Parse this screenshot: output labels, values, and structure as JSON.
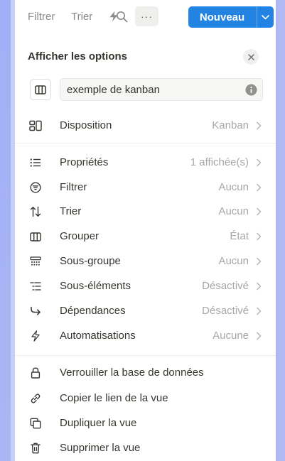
{
  "toolbar": {
    "filter_label": "Filtrer",
    "sort_label": "Trier",
    "automation_icon": "lightning-icon",
    "search_icon": "search-icon",
    "more_label": "···",
    "new_label": "Nouveau",
    "accent_color": "#2383e2"
  },
  "options": {
    "title": "Afficher les options",
    "view_name": "exemple de kanban"
  },
  "layout_row": {
    "icon": "layout-icon",
    "label": "Disposition",
    "value": "Kanban"
  },
  "settings": [
    {
      "icon": "list-icon",
      "label": "Propriétés",
      "value": "1 affichée(s)"
    },
    {
      "icon": "filter-icon",
      "label": "Filtrer",
      "value": "Aucun"
    },
    {
      "icon": "sort-icon",
      "label": "Trier",
      "value": "Aucun"
    },
    {
      "icon": "columns-icon",
      "label": "Grouper",
      "value": "État"
    },
    {
      "icon": "subgroup-icon",
      "label": "Sous-groupe",
      "value": "Aucun"
    },
    {
      "icon": "subitems-icon",
      "label": "Sous-éléments",
      "value": "Désactivé"
    },
    {
      "icon": "dependency-icon",
      "label": "Dépendances",
      "value": "Désactivé"
    },
    {
      "icon": "lightning-icon",
      "label": "Automatisations",
      "value": "Aucune"
    }
  ],
  "actions": [
    {
      "icon": "lock-icon",
      "label": "Verrouiller la base de données"
    },
    {
      "icon": "link-icon",
      "label": "Copier le lien de la vue"
    },
    {
      "icon": "duplicate-icon",
      "label": "Dupliquer la vue"
    },
    {
      "icon": "trash-icon",
      "label": "Supprimer la vue"
    }
  ]
}
